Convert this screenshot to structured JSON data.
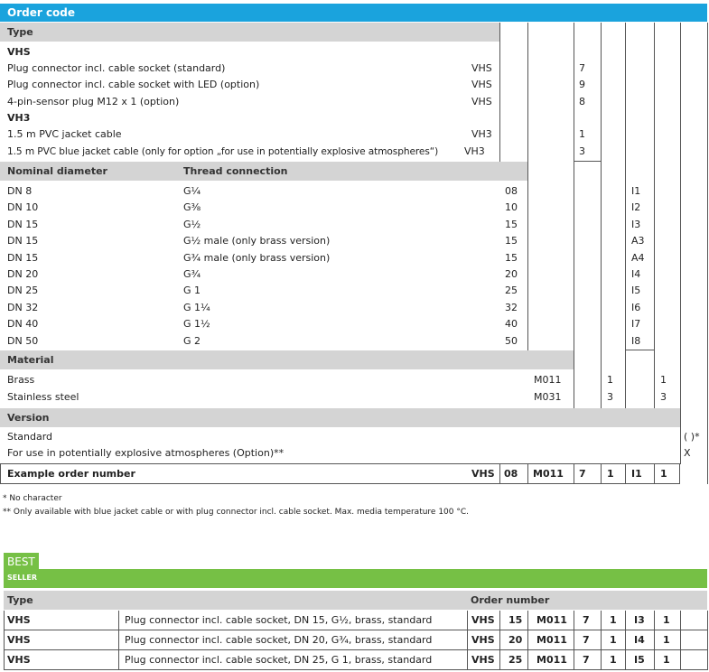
{
  "order_code_title": "Order code",
  "type_header": "Type",
  "vhs": {
    "group_label": "VHS",
    "items": [
      {
        "desc": "Plug connector incl. cable socket (standard)",
        "code": "VHS",
        "col": "7"
      },
      {
        "desc": "Plug connector incl. cable socket with LED (option)",
        "code": "VHS",
        "col": "9"
      },
      {
        "desc": "4-pin-sensor plug M12 x 1 (option)",
        "code": "VHS",
        "col": "8"
      }
    ]
  },
  "vh3": {
    "group_label": "VH3",
    "items": [
      {
        "desc": "1.5 m PVC jacket cable",
        "code": "VH3",
        "col": "1"
      },
      {
        "desc": "1.5 m PVC blue jacket cable (only for option „for use in potentially explosive atmospheres“)",
        "code": "VH3",
        "col": "3"
      }
    ]
  },
  "nominal": {
    "header_diameter": "Nominal diameter",
    "header_thread": "Thread connection",
    "rows": [
      {
        "dn": "DN 8",
        "thread": "G¼",
        "code": "08",
        "ic": "I1"
      },
      {
        "dn": "DN 10",
        "thread": "G⅜",
        "code": "10",
        "ic": "I2"
      },
      {
        "dn": "DN 15",
        "thread": "G½",
        "code": "15",
        "ic": "I3"
      },
      {
        "dn": "DN 15",
        "thread": "G½ male (only brass version)",
        "code": "15",
        "ic": "A3"
      },
      {
        "dn": "DN 15",
        "thread": "G¾ male (only brass version)",
        "code": "15",
        "ic": "A4"
      },
      {
        "dn": "DN 20",
        "thread": "G¾",
        "code": "20",
        "ic": "I4"
      },
      {
        "dn": "DN 25",
        "thread": "G 1",
        "code": "25",
        "ic": "I5"
      },
      {
        "dn": "DN 32",
        "thread": "G 1¼",
        "code": "32",
        "ic": "I6"
      },
      {
        "dn": "DN 40",
        "thread": "G 1½",
        "code": "40",
        "ic": "I7"
      },
      {
        "dn": "DN 50",
        "thread": "G 2",
        "code": "50",
        "ic": "I8"
      }
    ]
  },
  "material": {
    "header": "Material",
    "rows": [
      {
        "name": "Brass",
        "code": "M011",
        "a": "1",
        "b": "1"
      },
      {
        "name": "Stainless steel",
        "code": "M031",
        "a": "3",
        "b": "3"
      }
    ]
  },
  "version": {
    "header": "Version",
    "rows": [
      {
        "name": "Standard",
        "code": "( )*"
      },
      {
        "name": "For use in potentially explosive atmospheres (Option)**",
        "code": "X"
      }
    ]
  },
  "example": {
    "label": "Example order number",
    "codes": [
      "VHS",
      "08",
      "M011",
      "7",
      "1",
      "I1",
      "1"
    ]
  },
  "footnotes": [
    "*  No character",
    "** Only available with blue jacket cable or with plug connector incl. cable socket. Max. media temperature 100 °C."
  ],
  "best_seller": {
    "badge_line1": "BEST",
    "badge_line2": "SELLER",
    "header_type": "Type",
    "header_order": "Order number",
    "rows": [
      {
        "type": "VHS",
        "desc": "Plug connector incl. cable socket, DN 15, G½, brass, standard",
        "codes": [
          "VHS",
          "15",
          "M011",
          "7",
          "1",
          "I3",
          "1"
        ]
      },
      {
        "type": "VHS",
        "desc": "Plug connector incl. cable socket, DN 20, G¾, brass, standard",
        "codes": [
          "VHS",
          "20",
          "M011",
          "7",
          "1",
          "I4",
          "1"
        ]
      },
      {
        "type": "VHS",
        "desc": "Plug connector incl. cable socket, DN 25, G 1, brass, standard",
        "codes": [
          "VHS",
          "25",
          "M011",
          "7",
          "1",
          "I5",
          "1"
        ]
      }
    ]
  }
}
